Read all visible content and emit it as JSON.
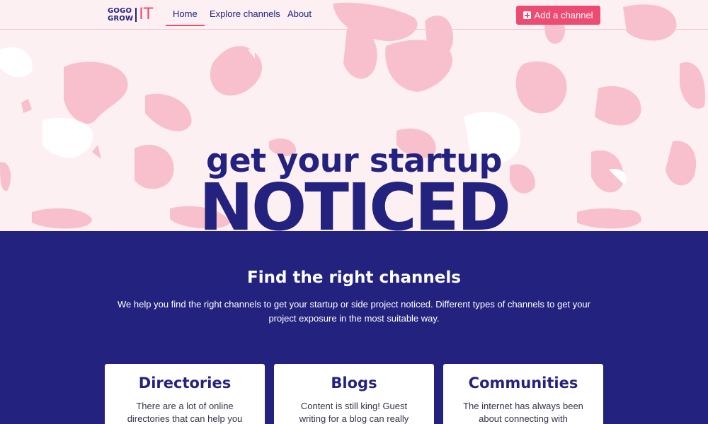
{
  "nav": {
    "logo_line1": "GOGO",
    "logo_line2": "GROW",
    "logo_it": "IT",
    "links": [
      {
        "label": "Home",
        "active": true
      },
      {
        "label": "Explore channels",
        "active": false
      },
      {
        "label": "About",
        "active": false
      }
    ],
    "add_button_label": "Add a channel",
    "add_button_icon": "plus-square-icon"
  },
  "hero": {
    "line1": "get your startup",
    "line2": "NOTICED"
  },
  "band": {
    "title": "Find the right channels",
    "text": "We help you find the right channels to get your startup or side project noticed. Different types of channels to get your project exposure in the most suitable way."
  },
  "cards": [
    {
      "title": "Directories",
      "text": "There are a lot of online directories that can help you"
    },
    {
      "title": "Blogs",
      "text": "Content is still king! Guest writing for a blog can really"
    },
    {
      "title": "Communities",
      "text": "The internet has always been about connecting with people."
    }
  ],
  "colors": {
    "brand_navy": "#24227f",
    "brand_pink": "#ee4b73",
    "blob_pink": "#f9c1cd",
    "hero_bg": "#fcf0f2"
  }
}
